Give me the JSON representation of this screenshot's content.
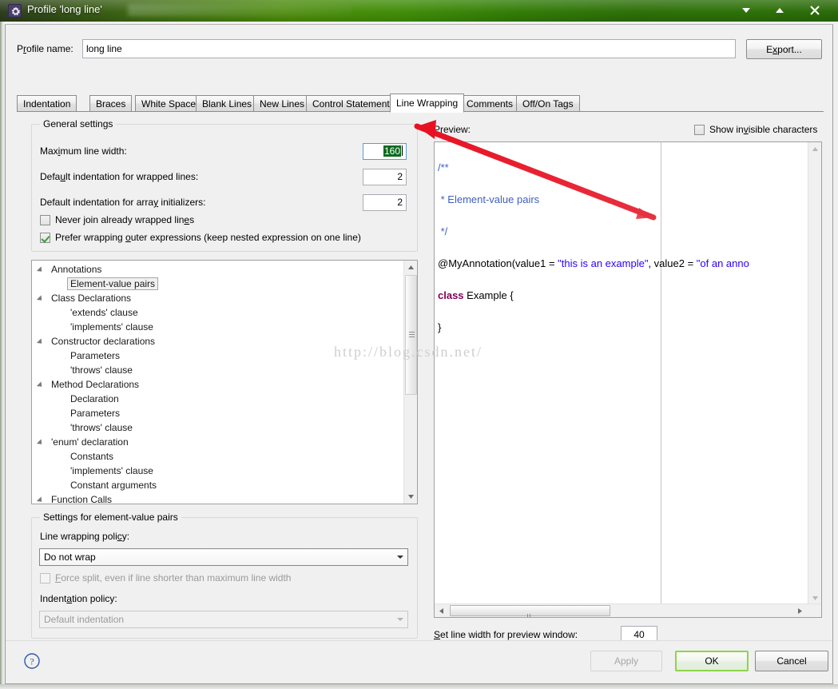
{
  "window": {
    "title": "Profile 'long line'",
    "icon": "gear-icon",
    "minimize_label": "▼",
    "maximize_label": "▲",
    "close_label": "✕",
    "accent_green": "#4a8a08",
    "focus_green": "#8ed44a"
  },
  "profile": {
    "label": "Profile name:",
    "value": "long line",
    "placeholder": "",
    "export_label": "Export..."
  },
  "tabs": [
    {
      "label": "Indentation",
      "selected": false
    },
    {
      "label": "Braces",
      "selected": false
    },
    {
      "label": "White Space",
      "selected": false
    },
    {
      "label": "Blank Lines",
      "selected": false
    },
    {
      "label": "New Lines",
      "selected": false
    },
    {
      "label": "Control Statements",
      "selected": false
    },
    {
      "label": "Line Wrapping",
      "selected": true
    },
    {
      "label": "Comments",
      "selected": false
    },
    {
      "label": "Off/On Tags",
      "selected": false
    }
  ],
  "general_settings": {
    "title": "General settings",
    "max_line_width_label": "Maximum line width:",
    "max_line_width_value": "160",
    "max_line_width_selected": true,
    "wrapped_indent_label": "Default indentation for wrapped lines:",
    "wrapped_indent_value": "2",
    "array_indent_label": "Default indentation for array initializers:",
    "array_indent_value": "2",
    "never_join_label": "Never join already wrapped lines",
    "never_join_checked": false,
    "prefer_outer_label": "Prefer wrapping outer expressions (keep nested expression on one line)",
    "prefer_outer_checked": true
  },
  "tree": [
    {
      "label": "Annotations",
      "level": 0,
      "expanded": true,
      "selected": false
    },
    {
      "label": "Element-value pairs",
      "level": 1,
      "expanded": false,
      "selected": true
    },
    {
      "label": "Class Declarations",
      "level": 0,
      "expanded": true,
      "selected": false
    },
    {
      "label": "'extends' clause",
      "level": 1,
      "expanded": false,
      "selected": false
    },
    {
      "label": "'implements' clause",
      "level": 1,
      "expanded": false,
      "selected": false
    },
    {
      "label": "Constructor declarations",
      "level": 0,
      "expanded": true,
      "selected": false
    },
    {
      "label": "Parameters",
      "level": 1,
      "expanded": false,
      "selected": false
    },
    {
      "label": "'throws' clause",
      "level": 1,
      "expanded": false,
      "selected": false
    },
    {
      "label": "Method Declarations",
      "level": 0,
      "expanded": true,
      "selected": false
    },
    {
      "label": "Declaration",
      "level": 1,
      "expanded": false,
      "selected": false
    },
    {
      "label": "Parameters",
      "level": 1,
      "expanded": false,
      "selected": false
    },
    {
      "label": "'throws' clause",
      "level": 1,
      "expanded": false,
      "selected": false
    },
    {
      "label": "'enum' declaration",
      "level": 0,
      "expanded": true,
      "selected": false
    },
    {
      "label": "Constants",
      "level": 1,
      "expanded": false,
      "selected": false
    },
    {
      "label": "'implements' clause",
      "level": 1,
      "expanded": false,
      "selected": false
    },
    {
      "label": "Constant arguments",
      "level": 1,
      "expanded": false,
      "selected": false
    },
    {
      "label": "Function Calls",
      "level": 0,
      "expanded": true,
      "selected": false
    }
  ],
  "settings_group": {
    "title": "Settings for element-value pairs",
    "line_wrapping_policy_label": "Line wrapping policy:",
    "line_wrapping_policy_value": "Do not wrap",
    "force_split_label": "Force split, even if line shorter than maximum line width",
    "force_split_checked": false,
    "force_split_disabled": true,
    "indentation_policy_label": "Indentation policy:",
    "indentation_policy_value": "Default indentation",
    "indentation_policy_disabled": true
  },
  "preview": {
    "label": "Preview:",
    "show_invisible_label": "Show invisible characters",
    "show_invisible_checked": false,
    "set_width_label": "Set line width for preview window:",
    "set_width_value": "40",
    "code_lines": [
      {
        "segments": [
          {
            "text": "/**",
            "style": "comment"
          }
        ]
      },
      {
        "segments": [
          {
            "text": " * Element-value pairs",
            "style": "comment"
          }
        ]
      },
      {
        "segments": [
          {
            "text": " */",
            "style": "comment"
          }
        ]
      },
      {
        "segments": [
          {
            "text": "@MyAnnotation(value1 = ",
            "style": "plain"
          },
          {
            "text": "\"this is an example\"",
            "style": "string"
          },
          {
            "text": ", value2 = ",
            "style": "plain"
          },
          {
            "text": "\"of an anno",
            "style": "string"
          }
        ]
      },
      {
        "segments": [
          {
            "text": "class",
            "style": "keyword"
          },
          {
            "text": " Example {",
            "style": "plain"
          }
        ]
      },
      {
        "segments": [
          {
            "text": "}",
            "style": "plain"
          }
        ]
      }
    ]
  },
  "footer": {
    "help_label": "?",
    "apply_label": "Apply",
    "apply_disabled": true,
    "ok_label": "OK",
    "cancel_label": "Cancel"
  },
  "watermark": {
    "text": "http://blog.csdn.net/"
  }
}
